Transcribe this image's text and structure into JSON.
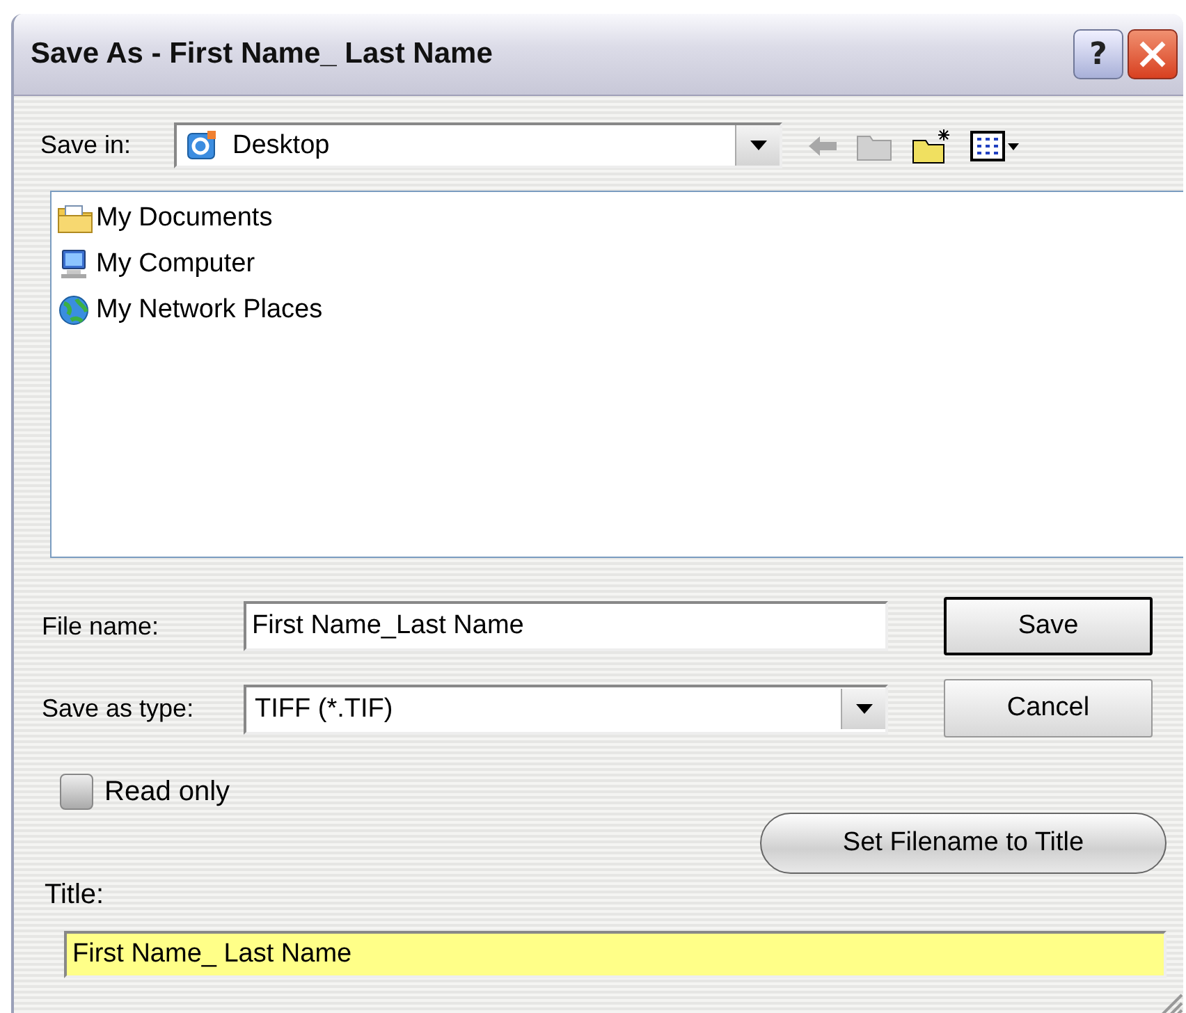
{
  "window": {
    "title": "Save As - First Name_ Last Name",
    "help_button": "?"
  },
  "save_in": {
    "label": "Save in:",
    "value": "Desktop"
  },
  "files": [
    {
      "name": "My Documents",
      "kind": "documents"
    },
    {
      "name": "My Computer",
      "kind": "computer"
    },
    {
      "name": "My Network Places",
      "kind": "network"
    }
  ],
  "file_name": {
    "label": "File name:",
    "value": "First Name_Last Name"
  },
  "save_as_type": {
    "label": "Save as type:",
    "value": "TIFF (*.TIF)"
  },
  "buttons": [
    {
      "label": "Save",
      "default": true
    },
    {
      "label": "Cancel",
      "default": false
    }
  ],
  "read_only": {
    "label": "Read only",
    "checked": false
  },
  "set_filename_button": "Set Filename to Title",
  "title_field": {
    "label": "Title:",
    "value": "First Name_ Last Name"
  }
}
